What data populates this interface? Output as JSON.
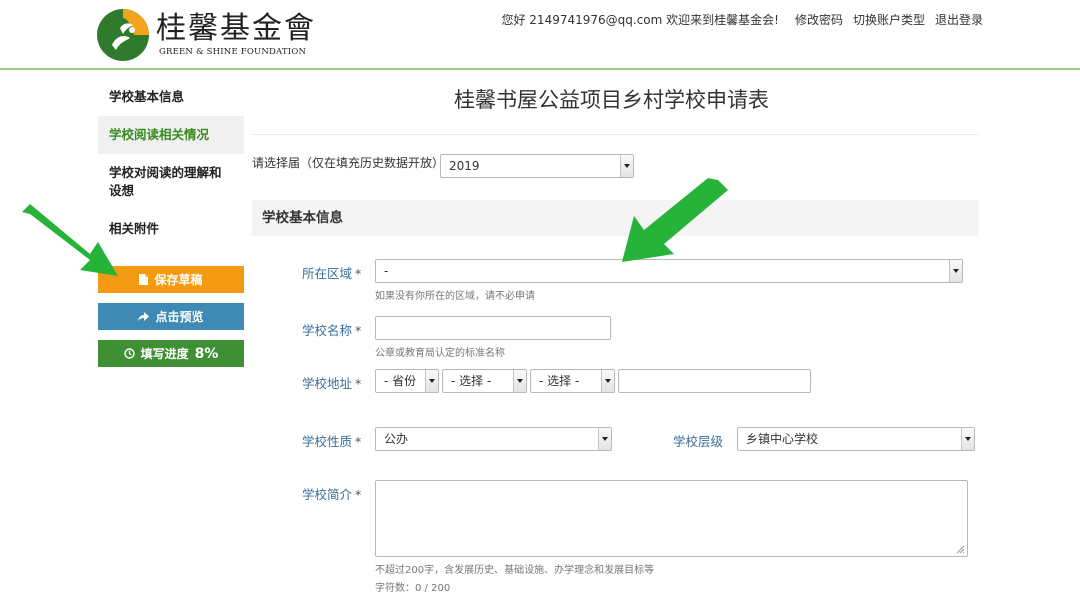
{
  "header": {
    "logo_cn": "桂馨基金會",
    "logo_en": "GREEN & SHINE FOUNDATION",
    "greeting": "您好 2149741976@qq.com 欢迎来到桂馨基金会!",
    "nav": [
      "修改密码",
      "切换账户类型",
      "退出登录"
    ]
  },
  "sidebar": {
    "items": [
      "学校基本信息",
      "学校阅读相关情况",
      "学校对阅读的理解和设想",
      "相关附件"
    ],
    "active_index": 1,
    "save_label": "保存草稿",
    "preview_label": "点击预览",
    "progress_label": "填写进度",
    "progress_value": "8%"
  },
  "page": {
    "title": "桂馨书屋公益项目乡村学校申请表"
  },
  "year": {
    "label": "请选择届（仅在填充历史数据开放）",
    "value": "2019"
  },
  "section": {
    "title": "学校基本信息"
  },
  "form": {
    "region": {
      "label": "所在区域",
      "value": "-",
      "hint": "如果没有你所在的区域，请不必申请"
    },
    "school_name": {
      "label": "学校名称",
      "value": "",
      "hint": "公章或教育局认定的标准名称"
    },
    "address": {
      "label": "学校地址",
      "province": "- 省份",
      "city": "- 选择 -",
      "district": "- 选择 -",
      "detail": ""
    },
    "nature": {
      "label": "学校性质",
      "value": "公办"
    },
    "level": {
      "label": "学校层级",
      "value": "乡镇中心学校"
    },
    "intro": {
      "label": "学校简介",
      "value": "",
      "hint": "不超过200字，含发展历史、基础设施、办学理念和发展目标等",
      "count": "字符数：0 / 200"
    },
    "required_mark": "*"
  },
  "colors": {
    "accent_green": "#3f8f35",
    "save_orange": "#f39a12",
    "preview_blue": "#3d8bb5",
    "label_blue": "#3a6e9c",
    "annotation_arrow": "#27b23a"
  }
}
